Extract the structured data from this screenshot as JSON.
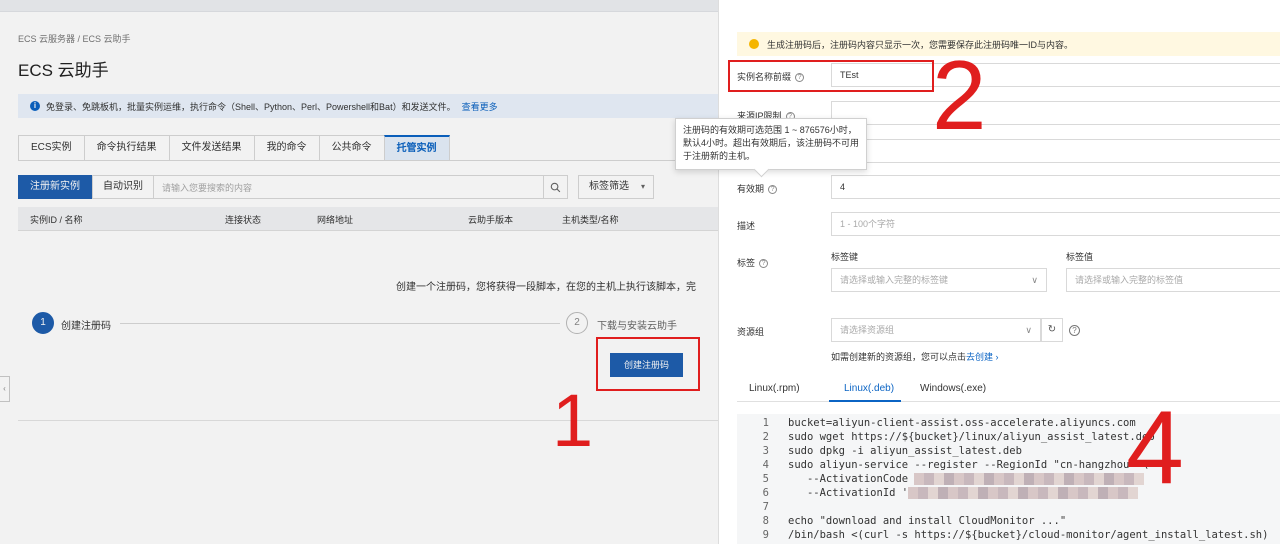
{
  "console": {
    "breadcrumb": "ECS 云服务器 / ECS 云助手",
    "title": "ECS 云助手",
    "notice": {
      "icon": "info-icon",
      "text": "免登录、免跳板机，批量实例运维，执行命令（Shell、Python、Perl、Powershell和Bat）和发送文件。",
      "link": "查看更多"
    },
    "tabs": [
      {
        "label": "ECS实例",
        "active": false
      },
      {
        "label": "命令执行结果",
        "active": false
      },
      {
        "label": "文件发送结果",
        "active": false
      },
      {
        "label": "我的命令",
        "active": false
      },
      {
        "label": "公共命令",
        "active": false
      },
      {
        "label": "托管实例",
        "active": true
      }
    ],
    "toolbar": {
      "register_label": "注册新实例",
      "auto_label": "自动识别",
      "search_placeholder": "请输入您要搜索的内容",
      "search_icon": "search-icon",
      "filter_label": "标签筛选"
    },
    "table_headers": [
      "实例ID / 名称",
      "连接状态",
      "网络地址",
      "云助手版本",
      "主机类型/名称"
    ],
    "empty_hint": "创建一个注册码，您将获得一段脚本，在您的主机上执行该脚本，完",
    "steps": [
      {
        "num": "1",
        "label": "创建注册码",
        "active": true
      },
      {
        "num": "2",
        "label": "下载与安装云助手",
        "active": false
      }
    ],
    "create_code_label": "创建注册码",
    "side_handle": "‹"
  },
  "drawer": {
    "warning": "生成注册码后，注册码内容只显示一次，您需要保存此注册码唯一ID与内容。",
    "fields": {
      "prefix_label": "实例名称前缀",
      "prefix_value": "TEst",
      "source_label": "来源IP限制",
      "validity_label": "有效期",
      "validity_value": "4",
      "desc_label": "描述",
      "desc_placeholder": "1 - 100个字符",
      "tag_label": "标签",
      "tag_key_label": "标签键",
      "tag_value_label": "标签值",
      "tag_key_placeholder": "请选择或输入完整的标签键",
      "tag_value_placeholder": "请选择或输入完整的标签值",
      "rg_label": "资源组",
      "rg_placeholder": "请选择资源组",
      "rg_hint": "如需创建新的资源组，您可以点击",
      "rg_link": "去创建 ›"
    },
    "tooltip": "注册码的有效期可选范围 1 ~ 876576小时，默认4小时。超出有效期后，该注册码不可用于注册新的主机。",
    "os_tabs": [
      {
        "label": "Linux(.rpm)",
        "active": false
      },
      {
        "label": "Linux(.deb)",
        "active": true
      },
      {
        "label": "Windows(.exe)",
        "active": false
      }
    ],
    "code_lines": [
      {
        "n": "1",
        "text": "bucket=aliyun-client-assist.oss-accelerate.aliyuncs.com"
      },
      {
        "n": "2",
        "text": "sudo wget https://${bucket}/linux/aliyun_assist_latest.deb"
      },
      {
        "n": "3",
        "text": "sudo dpkg -i aliyun_assist_latest.deb"
      },
      {
        "n": "4",
        "text": "sudo aliyun-service --register --RegionId \"cn-hangzhou\" \\"
      },
      {
        "n": "5",
        "text": "   --ActivationCode"
      },
      {
        "n": "6",
        "text": "   --ActivationId '"
      },
      {
        "n": "7",
        "text": ""
      },
      {
        "n": "8",
        "text": "echo \"download and install CloudMonitor ...\""
      },
      {
        "n": "9",
        "text": "/bin/bash <(curl -s https://${bucket}/cloud-monitor/agent_install_latest.sh)"
      }
    ]
  },
  "annotations": [
    "1",
    "2",
    "4"
  ],
  "colors": {
    "primary": "#1f5fb0",
    "link": "#0b64c4",
    "annotation": "#e01e1e",
    "warning": "#f5b500"
  }
}
